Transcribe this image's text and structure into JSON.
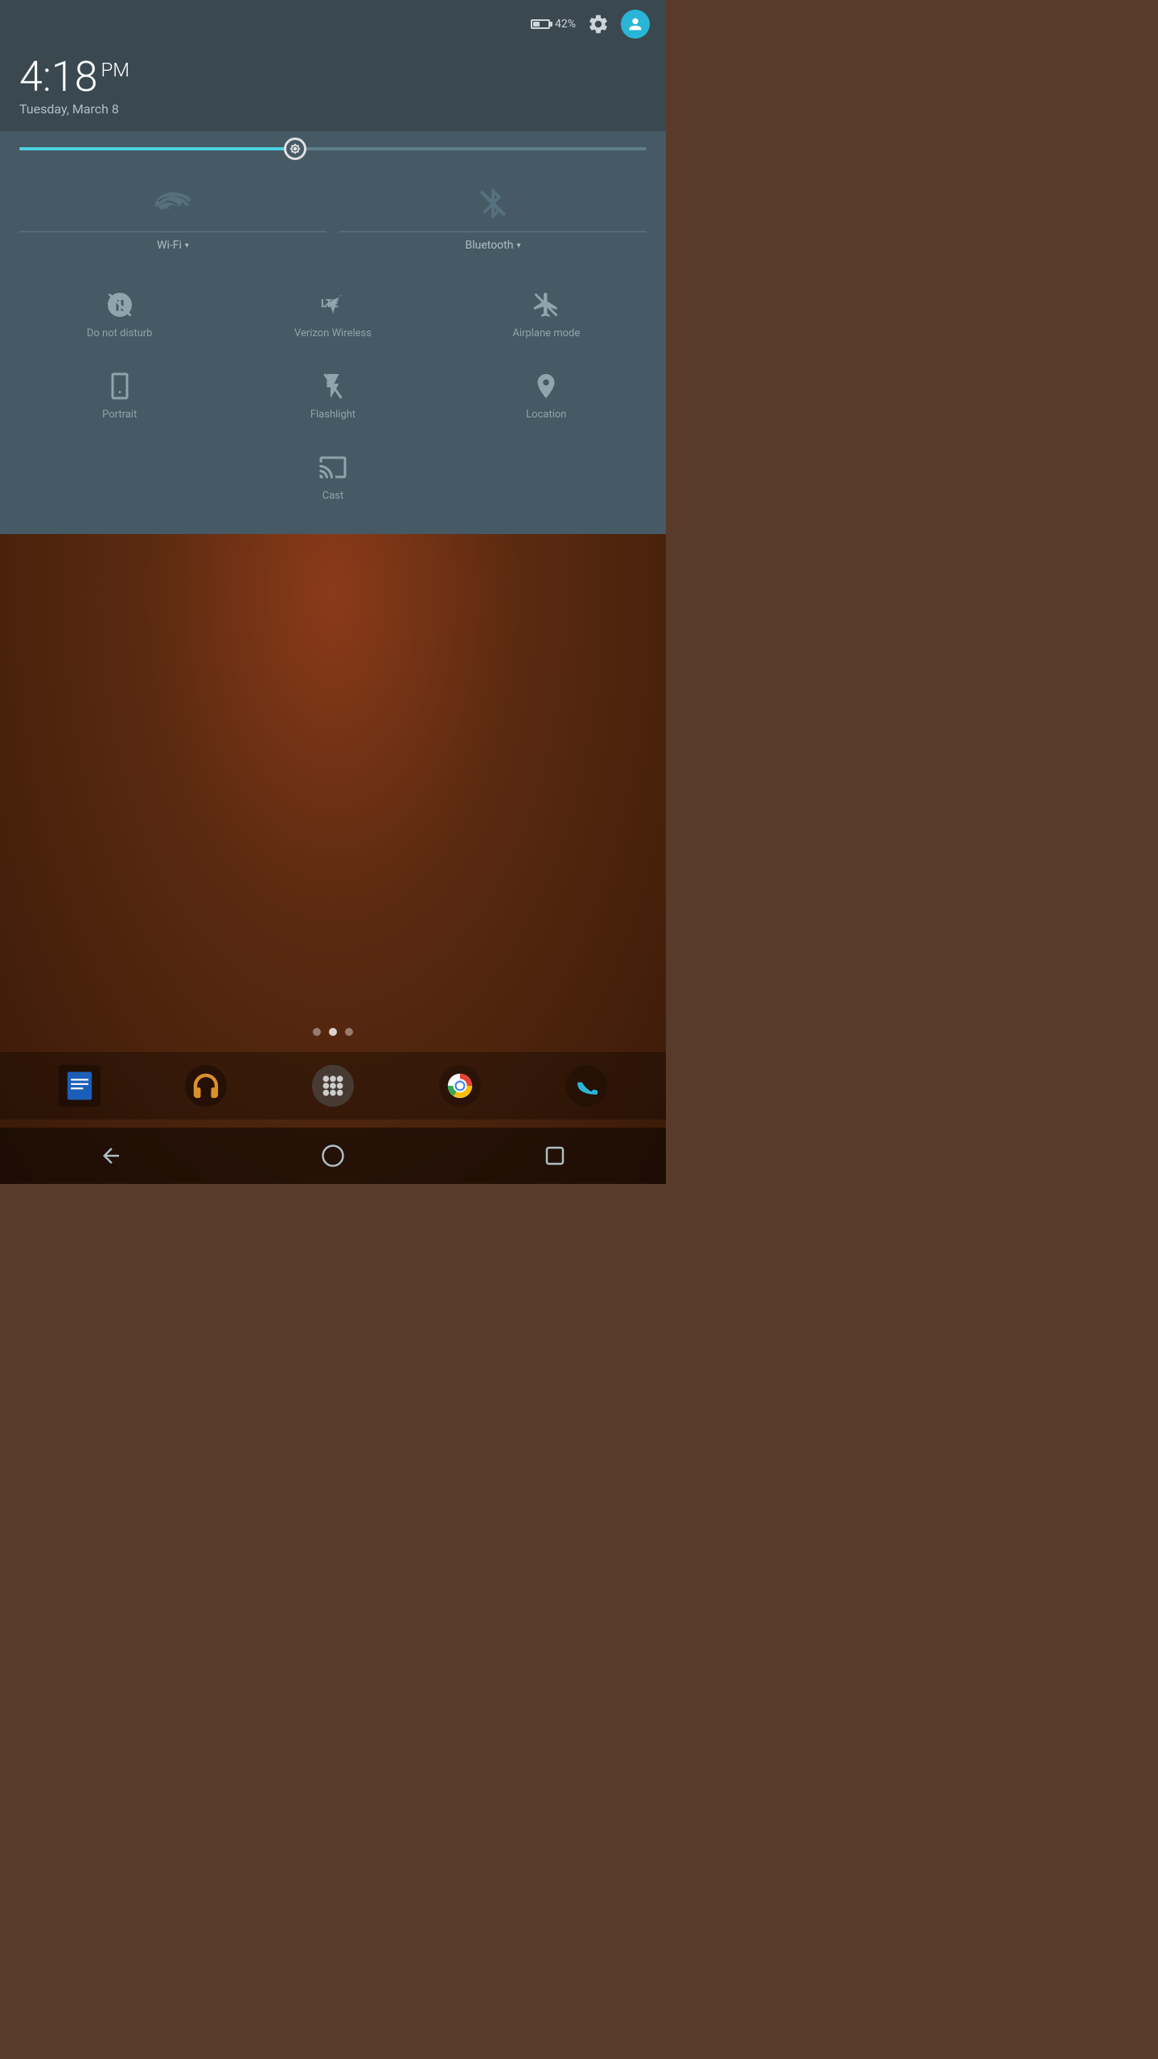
{
  "status_bar": {
    "battery_percent": "42%",
    "settings_label": "settings",
    "avatar_label": "user avatar"
  },
  "time_date": {
    "time": "4:18",
    "period": "PM",
    "date": "Tuesday, March 8"
  },
  "brightness": {
    "level": 44
  },
  "toggles": {
    "wifi": {
      "label": "Wi-Fi",
      "has_dropdown": true,
      "active": false
    },
    "bluetooth": {
      "label": "Bluetooth",
      "has_dropdown": true,
      "active": false
    }
  },
  "quick_tiles": [
    {
      "id": "do-not-disturb",
      "label": "Do not disturb"
    },
    {
      "id": "verizon-wireless",
      "label": "Verizon Wireless"
    },
    {
      "id": "airplane-mode",
      "label": "Airplane mode"
    },
    {
      "id": "portrait",
      "label": "Portrait"
    },
    {
      "id": "flashlight",
      "label": "Flashlight"
    },
    {
      "id": "location",
      "label": "Location"
    }
  ],
  "cast": {
    "label": "Cast"
  },
  "dock": {
    "apps": [
      "google-docs-icon",
      "headphones-icon",
      "app-drawer-icon",
      "chrome-icon",
      "phone-icon"
    ]
  },
  "nav": {
    "back": "back-icon",
    "home": "home-icon",
    "recents": "recents-icon"
  }
}
